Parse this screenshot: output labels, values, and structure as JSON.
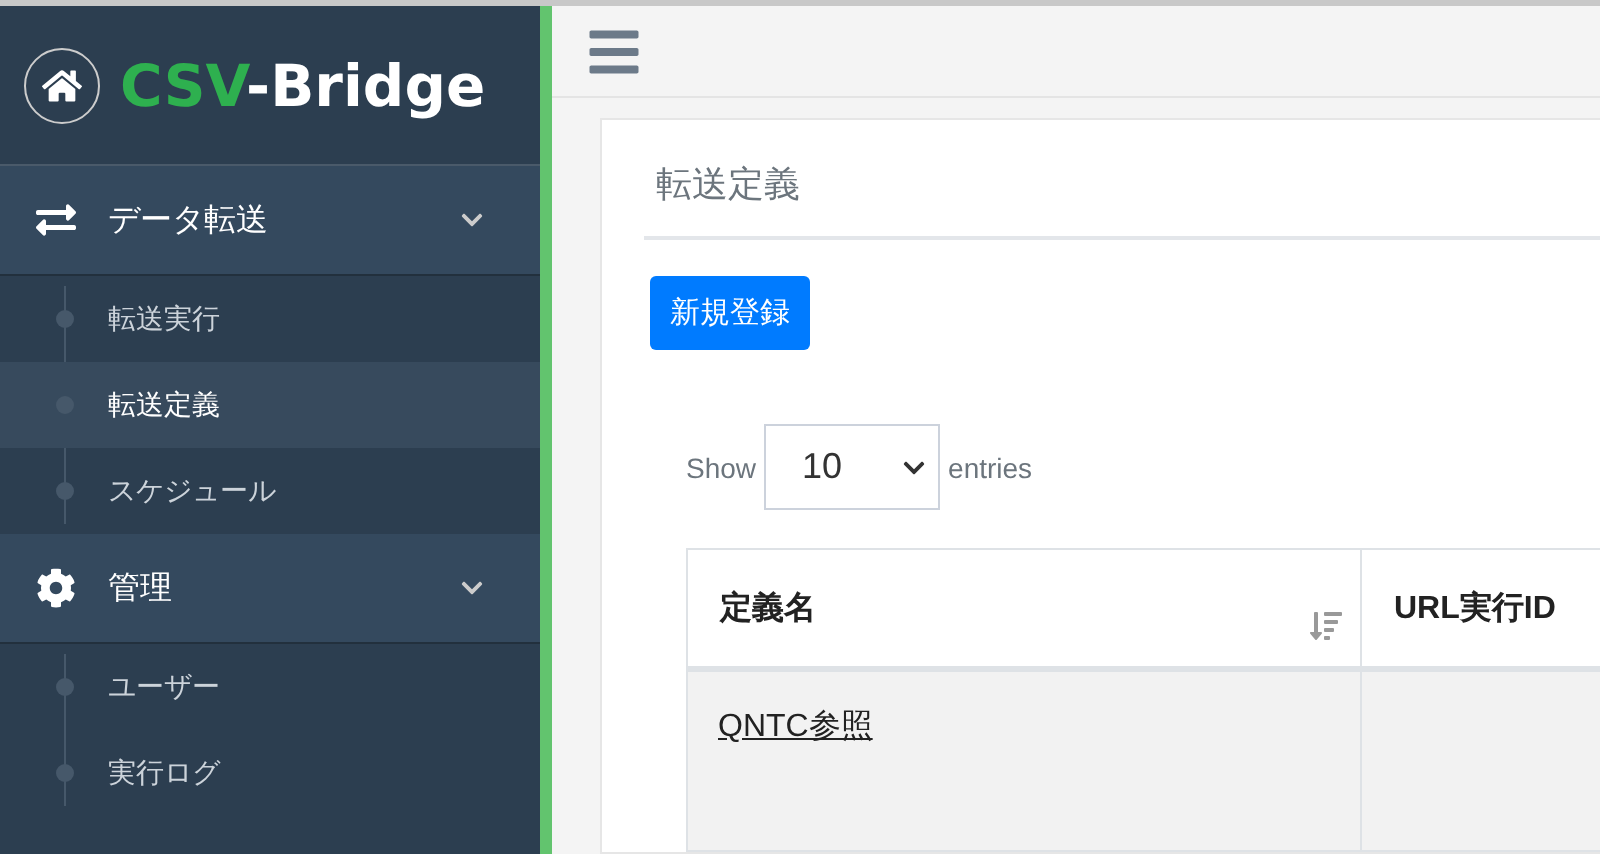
{
  "logo": {
    "prefix": "CSV",
    "suffix": "-Bridge"
  },
  "sidebar": {
    "sections": [
      {
        "label": "データ転送",
        "expanded": true,
        "children": [
          {
            "label": "転送実行",
            "selected": false
          },
          {
            "label": "転送定義",
            "selected": true
          },
          {
            "label": "スケジュール",
            "selected": false
          }
        ]
      },
      {
        "label": "管理",
        "expanded": true,
        "children": [
          {
            "label": "ユーザー",
            "selected": false
          },
          {
            "label": "実行ログ",
            "selected": false
          }
        ]
      }
    ]
  },
  "page": {
    "title": "転送定義",
    "new_button": "新規登録",
    "length": {
      "before": "Show",
      "value": "10",
      "after": "entries"
    }
  },
  "table": {
    "columns": [
      {
        "label": "定義名",
        "sorted": true
      },
      {
        "label": "URL実行ID"
      }
    ],
    "rows": [
      {
        "cells": [
          "QNTC参照",
          ""
        ]
      }
    ]
  }
}
